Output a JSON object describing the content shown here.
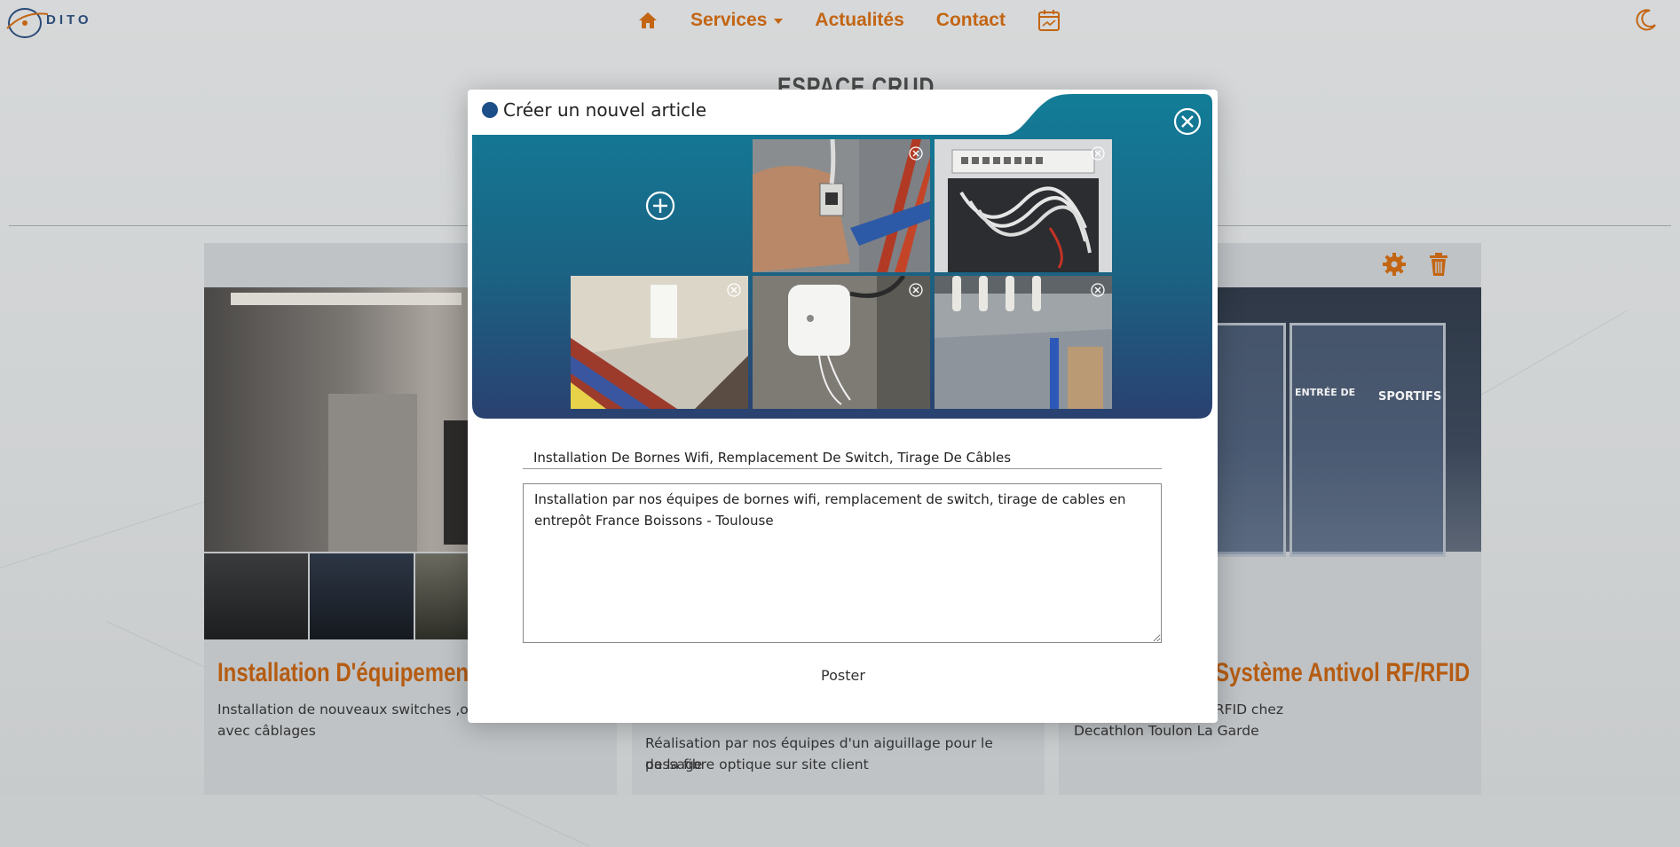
{
  "nav": {
    "logo_text": "DITO",
    "services": "Services",
    "news": "Actualités",
    "contact": "Contact"
  },
  "page": {
    "title": "ESPACE CRUD"
  },
  "cards": [
    {
      "title": "Installation D'équipements",
      "desc_line1": "Installation de nouveaux switches ,ondu",
      "desc_line2": "avec câblages"
    },
    {
      "desc_line1": "Réalisation par nos équipes d'un aiguillage pour le passage",
      "desc_line2": "de la fibre optique sur site client"
    },
    {
      "title": "Système Antivol RF/RFID",
      "desc_line1": "s antivols Nedap RF/RFID chez",
      "desc_line2": "Decathlon Toulon La Garde",
      "sign_left": "ENTRÉE DE",
      "sign_right": "SPORTIFS"
    }
  ],
  "modal": {
    "title": "Créer un nouvel article",
    "title_input": "Installation De Bornes Wifi, Remplacement De Switch, Tirage De Câbles",
    "body_text": "Installation par nos équipes de bornes wifi, remplacement de switch, tirage de cables en entrepôt France Boissons - Toulouse",
    "post_label": "Poster"
  },
  "colors": {
    "accent": "#c36513",
    "modal_dot": "#1c4f88",
    "banner_top": "#0f7a95",
    "banner_bottom": "#26446e"
  },
  "icons": [
    "home-icon",
    "calendar-icon",
    "moon-icon",
    "settings-icon",
    "trash-icon",
    "close-icon",
    "add-icon",
    "remove-image-icon"
  ]
}
